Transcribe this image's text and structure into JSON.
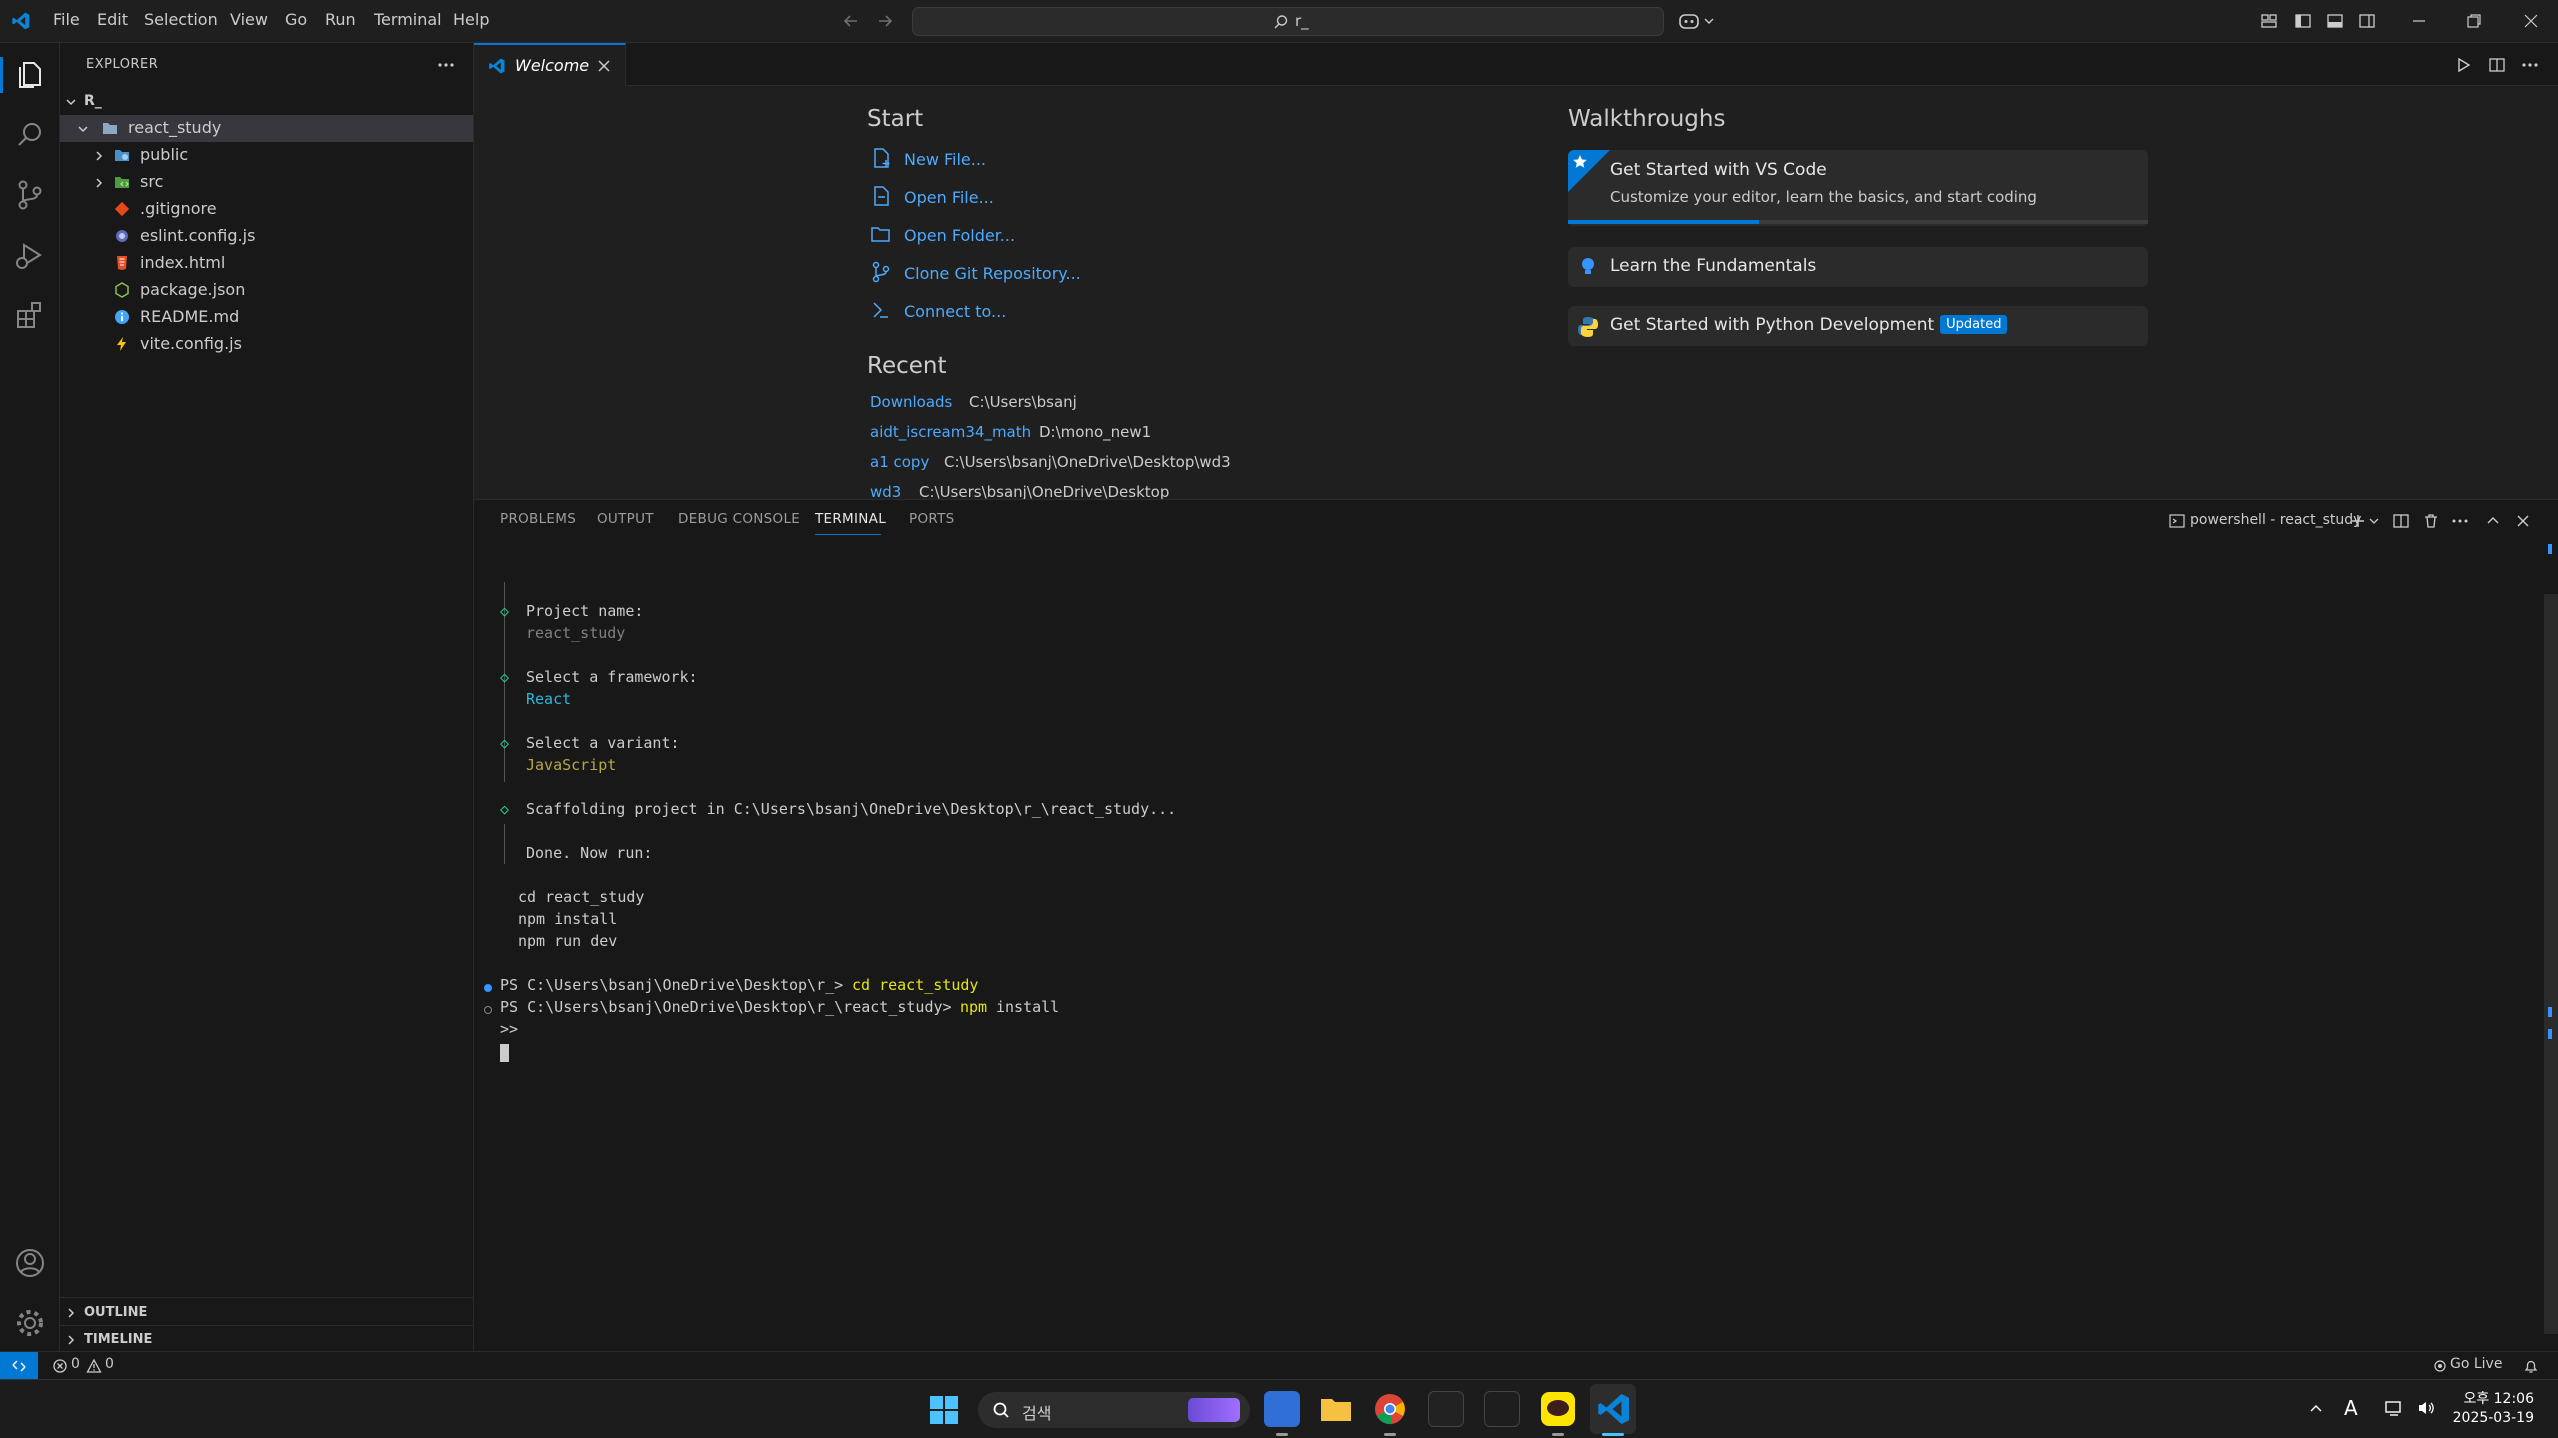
{
  "titlebar": {
    "menu": [
      "File",
      "Edit",
      "Selection",
      "View",
      "Go",
      "Run",
      "Terminal",
      "Help"
    ],
    "search_text": "r_"
  },
  "sidebar": {
    "title": "EXPLORER",
    "root": "R_",
    "folder": "react_study",
    "items": [
      {
        "label": "public",
        "kind": "folder"
      },
      {
        "label": "src",
        "kind": "folder"
      },
      {
        "label": ".gitignore",
        "kind": "file"
      },
      {
        "label": "eslint.config.js",
        "kind": "file"
      },
      {
        "label": "index.html",
        "kind": "file"
      },
      {
        "label": "package.json",
        "kind": "file"
      },
      {
        "label": "README.md",
        "kind": "file"
      },
      {
        "label": "vite.config.js",
        "kind": "file"
      }
    ],
    "outline": "OUTLINE",
    "timeline": "TIMELINE"
  },
  "editor": {
    "tab_label": "Welcome"
  },
  "welcome": {
    "start_title": "Start",
    "start_links": [
      "New File...",
      "Open File...",
      "Open Folder...",
      "Clone Git Repository...",
      "Connect to..."
    ],
    "recent_title": "Recent",
    "recent": [
      {
        "name": "Downloads",
        "path": "C:\\Users\\bsanj"
      },
      {
        "name": "aidt_iscream34_math",
        "path": "D:\\mono_new1"
      },
      {
        "name": "a1 copy",
        "path": "C:\\Users\\bsanj\\OneDrive\\Desktop\\wd3"
      },
      {
        "name": "wd3",
        "path": "C:\\Users\\bsanj\\OneDrive\\Desktop"
      }
    ],
    "walkthroughs_title": "Walkthroughs",
    "walk1_title": "Get Started with VS Code",
    "walk1_desc": "Customize your editor, learn the basics, and start coding",
    "walk1_progress": 0.33,
    "walk2_title": "Learn the Fundamentals",
    "walk3_title": "Get Started with Python Development",
    "walk3_badge": "Updated"
  },
  "panel": {
    "tabs": [
      "PROBLEMS",
      "OUTPUT",
      "DEBUG CONSOLE",
      "TERMINAL",
      "PORTS"
    ],
    "active_tab": "TERMINAL",
    "terminal_name": "powershell - react_study"
  },
  "terminal": {
    "project_name_label": "Project name:",
    "project_name_value": "react_study",
    "framework_label": "Select a framework:",
    "framework_value": "React",
    "variant_label": "Select a variant:",
    "variant_value": "JavaScript",
    "scaffold_line": "Scaffolding project in C:\\Users\\bsanj\\OneDrive\\Desktop\\r_\\react_study...",
    "done_line": "Done. Now run:",
    "cmd1": "cd react_study",
    "cmd2": "npm install",
    "cmd3": "npm run dev",
    "prompt1": "PS C:\\Users\\bsanj\\OneDrive\\Desktop\\r_>",
    "prompt1_cmd": "cd react_study",
    "prompt2": "PS C:\\Users\\bsanj\\OneDrive\\Desktop\\r_\\react_study>",
    "prompt2_cmd_npm": "npm",
    "prompt2_cmd_rest": "install",
    "continuation": ">>"
  },
  "statusbar": {
    "errors": "0",
    "warnings": "0",
    "go_live": "Go Live"
  },
  "taskbar": {
    "search_placeholder": "검색",
    "time": "오후 12:06",
    "date": "2025-03-19",
    "ime": "A"
  },
  "colors": {
    "accent": "#0078d4",
    "link": "#4daafc",
    "terminal_green": "#23d18b",
    "terminal_cyan": "#29b8db",
    "terminal_yellow": "#b5a642"
  }
}
